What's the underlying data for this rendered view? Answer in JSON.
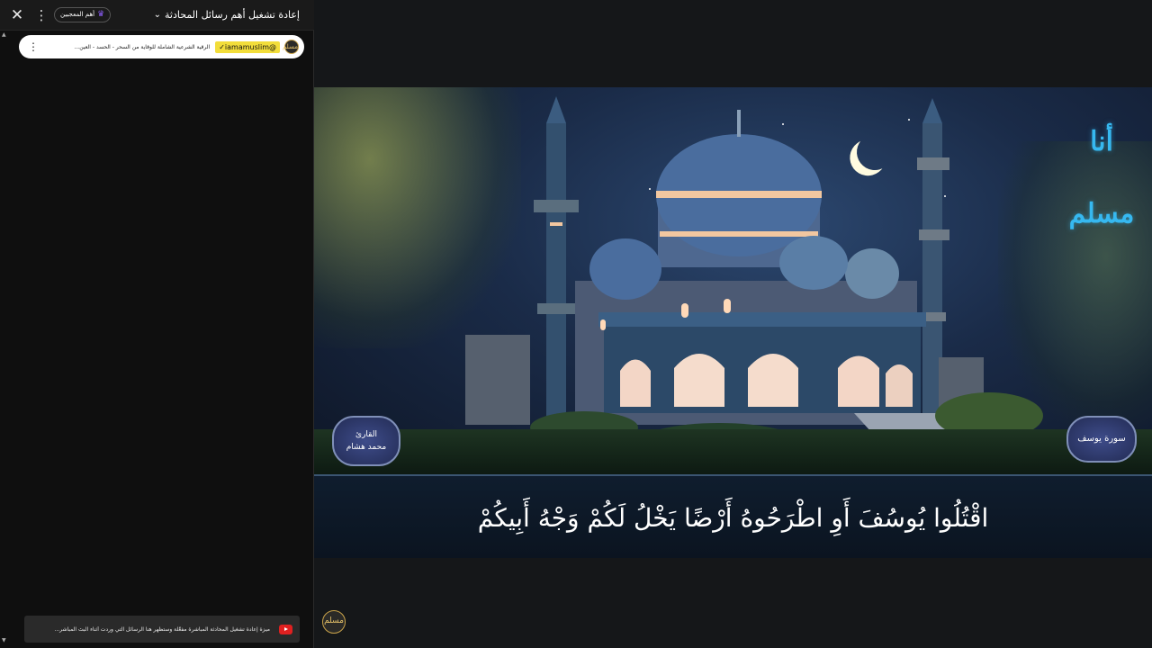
{
  "chat": {
    "title": "إعادة تشغيل أهم رسائل المحادثة",
    "top_fans_label": "أهم المعجبين",
    "pinned": {
      "avatar_text": "مسلم",
      "handle": "@iamamuslim✓",
      "text": "الرقية الشرعية الشاملة للوقاية من السحر - الحسد - العين..."
    },
    "notice": {
      "text": "ميزة إعادة تشغيل المحادثة المباشرة مفعّلة وستظهر هنا الرسائل التي وردت أثناء البث المباشر..."
    }
  },
  "video": {
    "station_logo": "أنا مسلم",
    "reciter": {
      "line1": "القارئ",
      "line2": "محمد هشام"
    },
    "surah": "سورة يوسف",
    "verse": "اقْتُلُوا يُوسُفَ أَوِ اطْرَحُوهُ أَرْضًا يَخْلُ لَكُمْ وَجْهُ أَبِيكُمْ",
    "channel_logo": "مسلم"
  },
  "icons": {
    "close": "close-icon",
    "more": "more-vert-icon",
    "crown": "crown-icon",
    "chevron": "chevron-down-icon",
    "youtube": "youtube-icon"
  },
  "colors": {
    "handle_highlight": "#f2dd3a",
    "youtube_red": "#e02020",
    "logo_blue": "#36b8f0"
  }
}
